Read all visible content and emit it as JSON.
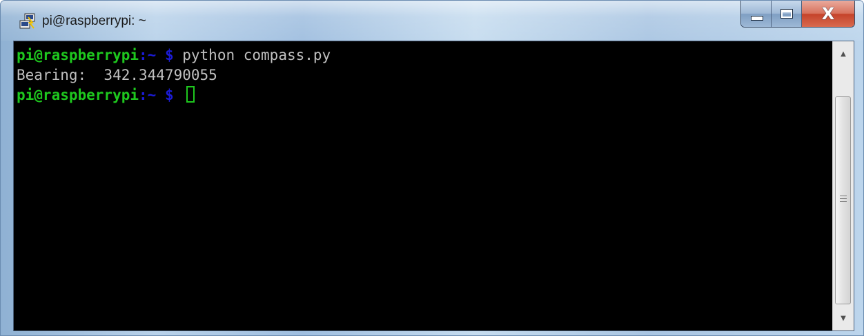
{
  "window": {
    "title": "pi@raspberrypi: ~",
    "icon": "putty-terminal-icon",
    "controls": {
      "minimize": "minimize-icon",
      "maximize": "maximize-icon",
      "close_glyph": "X"
    }
  },
  "terminal": {
    "line1": {
      "user_host": "pi@raspberrypi",
      "path": ":~",
      "dollar": " $ ",
      "command": "python compass.py"
    },
    "line2": {
      "output": "Bearing:  342.344790055"
    },
    "line3": {
      "user_host": "pi@raspberrypi",
      "path": ":~",
      "dollar": " $ "
    }
  },
  "colors": {
    "prompt_user": "#1ec81e",
    "prompt_path": "#1b1bd6",
    "text": "#c0c0c0",
    "background": "#000000",
    "close_button": "#c5432a"
  }
}
